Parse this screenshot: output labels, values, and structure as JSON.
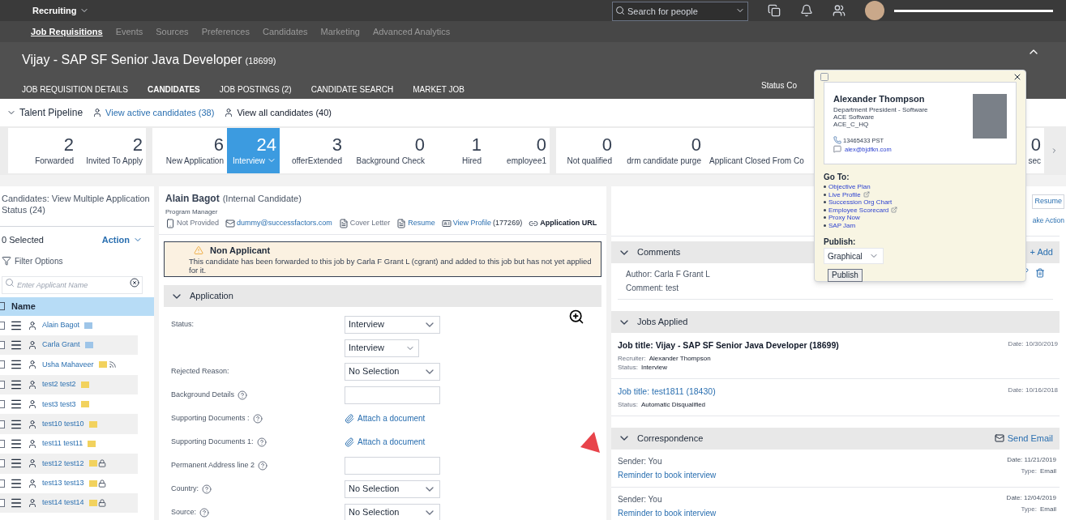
{
  "top_bar": {
    "module": "Recruiting",
    "search": {
      "placeholder": "Search for people"
    }
  },
  "subnav": [
    {
      "label": "Job Requisitions",
      "selected": true
    },
    {
      "label": "Events",
      "selected": false
    },
    {
      "label": "Sources",
      "selected": false
    },
    {
      "label": "Preferences",
      "selected": false
    },
    {
      "label": "Candidates",
      "selected": false
    },
    {
      "label": "Marketing",
      "selected": false
    },
    {
      "label": "Advanced Analytics",
      "selected": false
    }
  ],
  "requisition": {
    "title": "Vijay - SAP SF Senior Java Developer",
    "id": "(18699)",
    "status": "Status Co",
    "tabs": [
      {
        "label": "JOB REQUISITION DETAILS",
        "selected": false
      },
      {
        "label": "CANDIDATES",
        "selected": true
      },
      {
        "label": "JOB POSTINGS (2)",
        "selected": false
      },
      {
        "label": "CANDIDATE SEARCH",
        "selected": false
      },
      {
        "label": "MARKET JOB",
        "selected": false
      }
    ]
  },
  "pipeline": {
    "title": "Talent Pipeline",
    "view_active": "View active candidates (38)",
    "view_all": "View all candidates (40)",
    "groups": [
      [
        {
          "count": "2",
          "label": "Forwarded",
          "selected": false
        },
        {
          "count": "2",
          "label": "Invited To Apply",
          "selected": false
        }
      ],
      [
        {
          "count": "6",
          "label": "New Application",
          "selected": false
        },
        {
          "count": "24",
          "label": "Interview",
          "selected": true
        },
        {
          "count": "3",
          "label": "offerExtended",
          "selected": false
        },
        {
          "count": "0",
          "label": "Background Check",
          "selected": false
        },
        {
          "count": "1",
          "label": "Hired",
          "selected": false
        },
        {
          "count": "0",
          "label": "employee1",
          "selected": false
        }
      ],
      [
        {
          "count": "0",
          "label": "Not qualified",
          "selected": false
        },
        {
          "count": "0",
          "label": "drm candidate purge",
          "selected": false
        },
        {
          "label": "Applicant Closed From Co",
          "selected": false
        },
        {
          "count": "0",
          "label": "sec",
          "selected": false
        }
      ]
    ]
  },
  "candidates_panel": {
    "title": "Candidates: View Multiple Application Status (24)",
    "selected_count": "0 Selected",
    "action": "Action",
    "filter": "Filter Options",
    "search": {
      "placeholder": "Enter Applicant Name"
    },
    "header": "Name",
    "header_checked": false,
    "rows": [
      {
        "name": "Alain Bagot",
        "checked": false,
        "color": "#9ec5e8",
        "kind": "plain"
      },
      {
        "name": "Carla Grant",
        "checked": false,
        "color": "#9ec5e8",
        "kind": "plain"
      },
      {
        "name": "Usha Mahaveer",
        "checked": false,
        "color": "#f2d25e",
        "kind": "feed"
      },
      {
        "name": "test2 test2",
        "checked": false,
        "color": "#f2d25e",
        "kind": "plain"
      },
      {
        "name": "test3 test3",
        "checked": false,
        "color": "#f2d25e",
        "kind": "plain"
      },
      {
        "name": "test10 test10",
        "checked": false,
        "color": "#f2d25e",
        "kind": "plain"
      },
      {
        "name": "test11 test11",
        "checked": false,
        "color": "#f2d25e",
        "kind": "plain"
      },
      {
        "name": "test12 test12",
        "checked": false,
        "color": "#f2d25e",
        "kind": "lock"
      },
      {
        "name": "test13 test13",
        "checked": false,
        "color": "#f2d25e",
        "kind": "lock"
      },
      {
        "name": "test14 test14",
        "checked": false,
        "color": "#f2d25e",
        "kind": "lock"
      }
    ]
  },
  "candidate": {
    "name": "Alain Bagot",
    "note": "(Internal Candidate)",
    "role": "Program Manager",
    "contacts": [
      {
        "kind": "phone",
        "text": "Not Provided"
      },
      {
        "kind": "email",
        "text": "dummy@successfactors.com"
      },
      {
        "kind": "cover",
        "text": "Cover Letter"
      },
      {
        "kind": "resume",
        "text": "Resume"
      },
      {
        "kind": "profile",
        "text": "View Profile",
        "suffix": "(177269)"
      },
      {
        "kind": "url",
        "text": "Application URL"
      }
    ]
  },
  "notice": {
    "title": "Non Applicant",
    "text": "This candidate has been forwarded to this job by Carla F Grant L (cgrant) and added to this job but has not yet applied for it."
  },
  "application": {
    "title": "Application",
    "expanded": true,
    "fields": [
      {
        "label": "Status:",
        "help": false,
        "kind": "select",
        "value": "Interview"
      },
      {
        "kind": "select_small",
        "value": "Interview"
      },
      {
        "label": "Rejected Reason:",
        "help": false,
        "kind": "select",
        "value": "No Selection"
      },
      {
        "label": "Background Details",
        "help": true,
        "kind": "text"
      },
      {
        "label": "Supporting Documents :",
        "help": true,
        "kind": "attach",
        "value": "Attach a document"
      },
      {
        "label": "Supporting Documents 1:",
        "help": true,
        "kind": "attach",
        "value": "Attach a document"
      },
      {
        "label": "Permanent Address line 2",
        "help": true,
        "kind": "text"
      },
      {
        "label": "Country:",
        "help": true,
        "kind": "select",
        "value": "No Selection"
      },
      {
        "label": "Source:",
        "help": true,
        "kind": "select",
        "value": "No Selection"
      }
    ]
  },
  "side": {
    "resume_button": "Resume",
    "take_action": "ake Action",
    "comments": {
      "title": "Comments",
      "expanded": true,
      "add": "+ Add",
      "items": [
        {
          "author": "Author: Carla F Grant L",
          "comment": "Comment: test"
        }
      ]
    },
    "jobs_applied": {
      "title": "Jobs Applied",
      "expanded": true,
      "items": [
        {
          "title": "Job title: Vijay - SAP SF Senior Java Developer (18699)",
          "link": false,
          "date": "Date: 10/30/2019",
          "details": [
            {
              "label": "Recruiter:",
              "value": "Alexander Thompson"
            },
            {
              "label": "Status:",
              "value": "Interview"
            }
          ]
        },
        {
          "title": "Job title: test1811 (18430)",
          "link": true,
          "date": "Date: 10/16/2018",
          "details": [
            {
              "label": "Status:",
              "value": "Automatic Disqualified"
            }
          ]
        }
      ]
    },
    "correspondence": {
      "title": "Correspondence",
      "expanded": true,
      "send": "Send Email",
      "items": [
        {
          "sender": "Sender: You",
          "subject": "Reminder to book interview",
          "date": "Date: 11/21/2019",
          "type_label": "Type:",
          "type": "Email"
        },
        {
          "sender": "Sender: You",
          "subject": "Reminder to book interview",
          "date": "Date: 12/04/2019",
          "type_label": "Type:",
          "type": "Email"
        }
      ]
    }
  },
  "popup": {
    "name": "Alexander Thompson",
    "lines": [
      "Department President - Software",
      "ACE Software",
      "ACE_C_HQ"
    ],
    "phone": "13465433 PST",
    "email": "alex@bjdfkn.com",
    "goto_title": "Go To:",
    "goto": [
      {
        "label": "Objective Plan",
        "external": false
      },
      {
        "label": "Live Profile",
        "external": true
      },
      {
        "label": "Succession Org Chart",
        "external": false
      },
      {
        "label": "Employee Scorecard",
        "external": true
      },
      {
        "label": "Proxy Now",
        "external": false
      },
      {
        "label": "SAP Jam",
        "external": false
      }
    ],
    "publish_label": "Publish:",
    "publish_value": "Graphical",
    "publish_button": "Publish"
  }
}
